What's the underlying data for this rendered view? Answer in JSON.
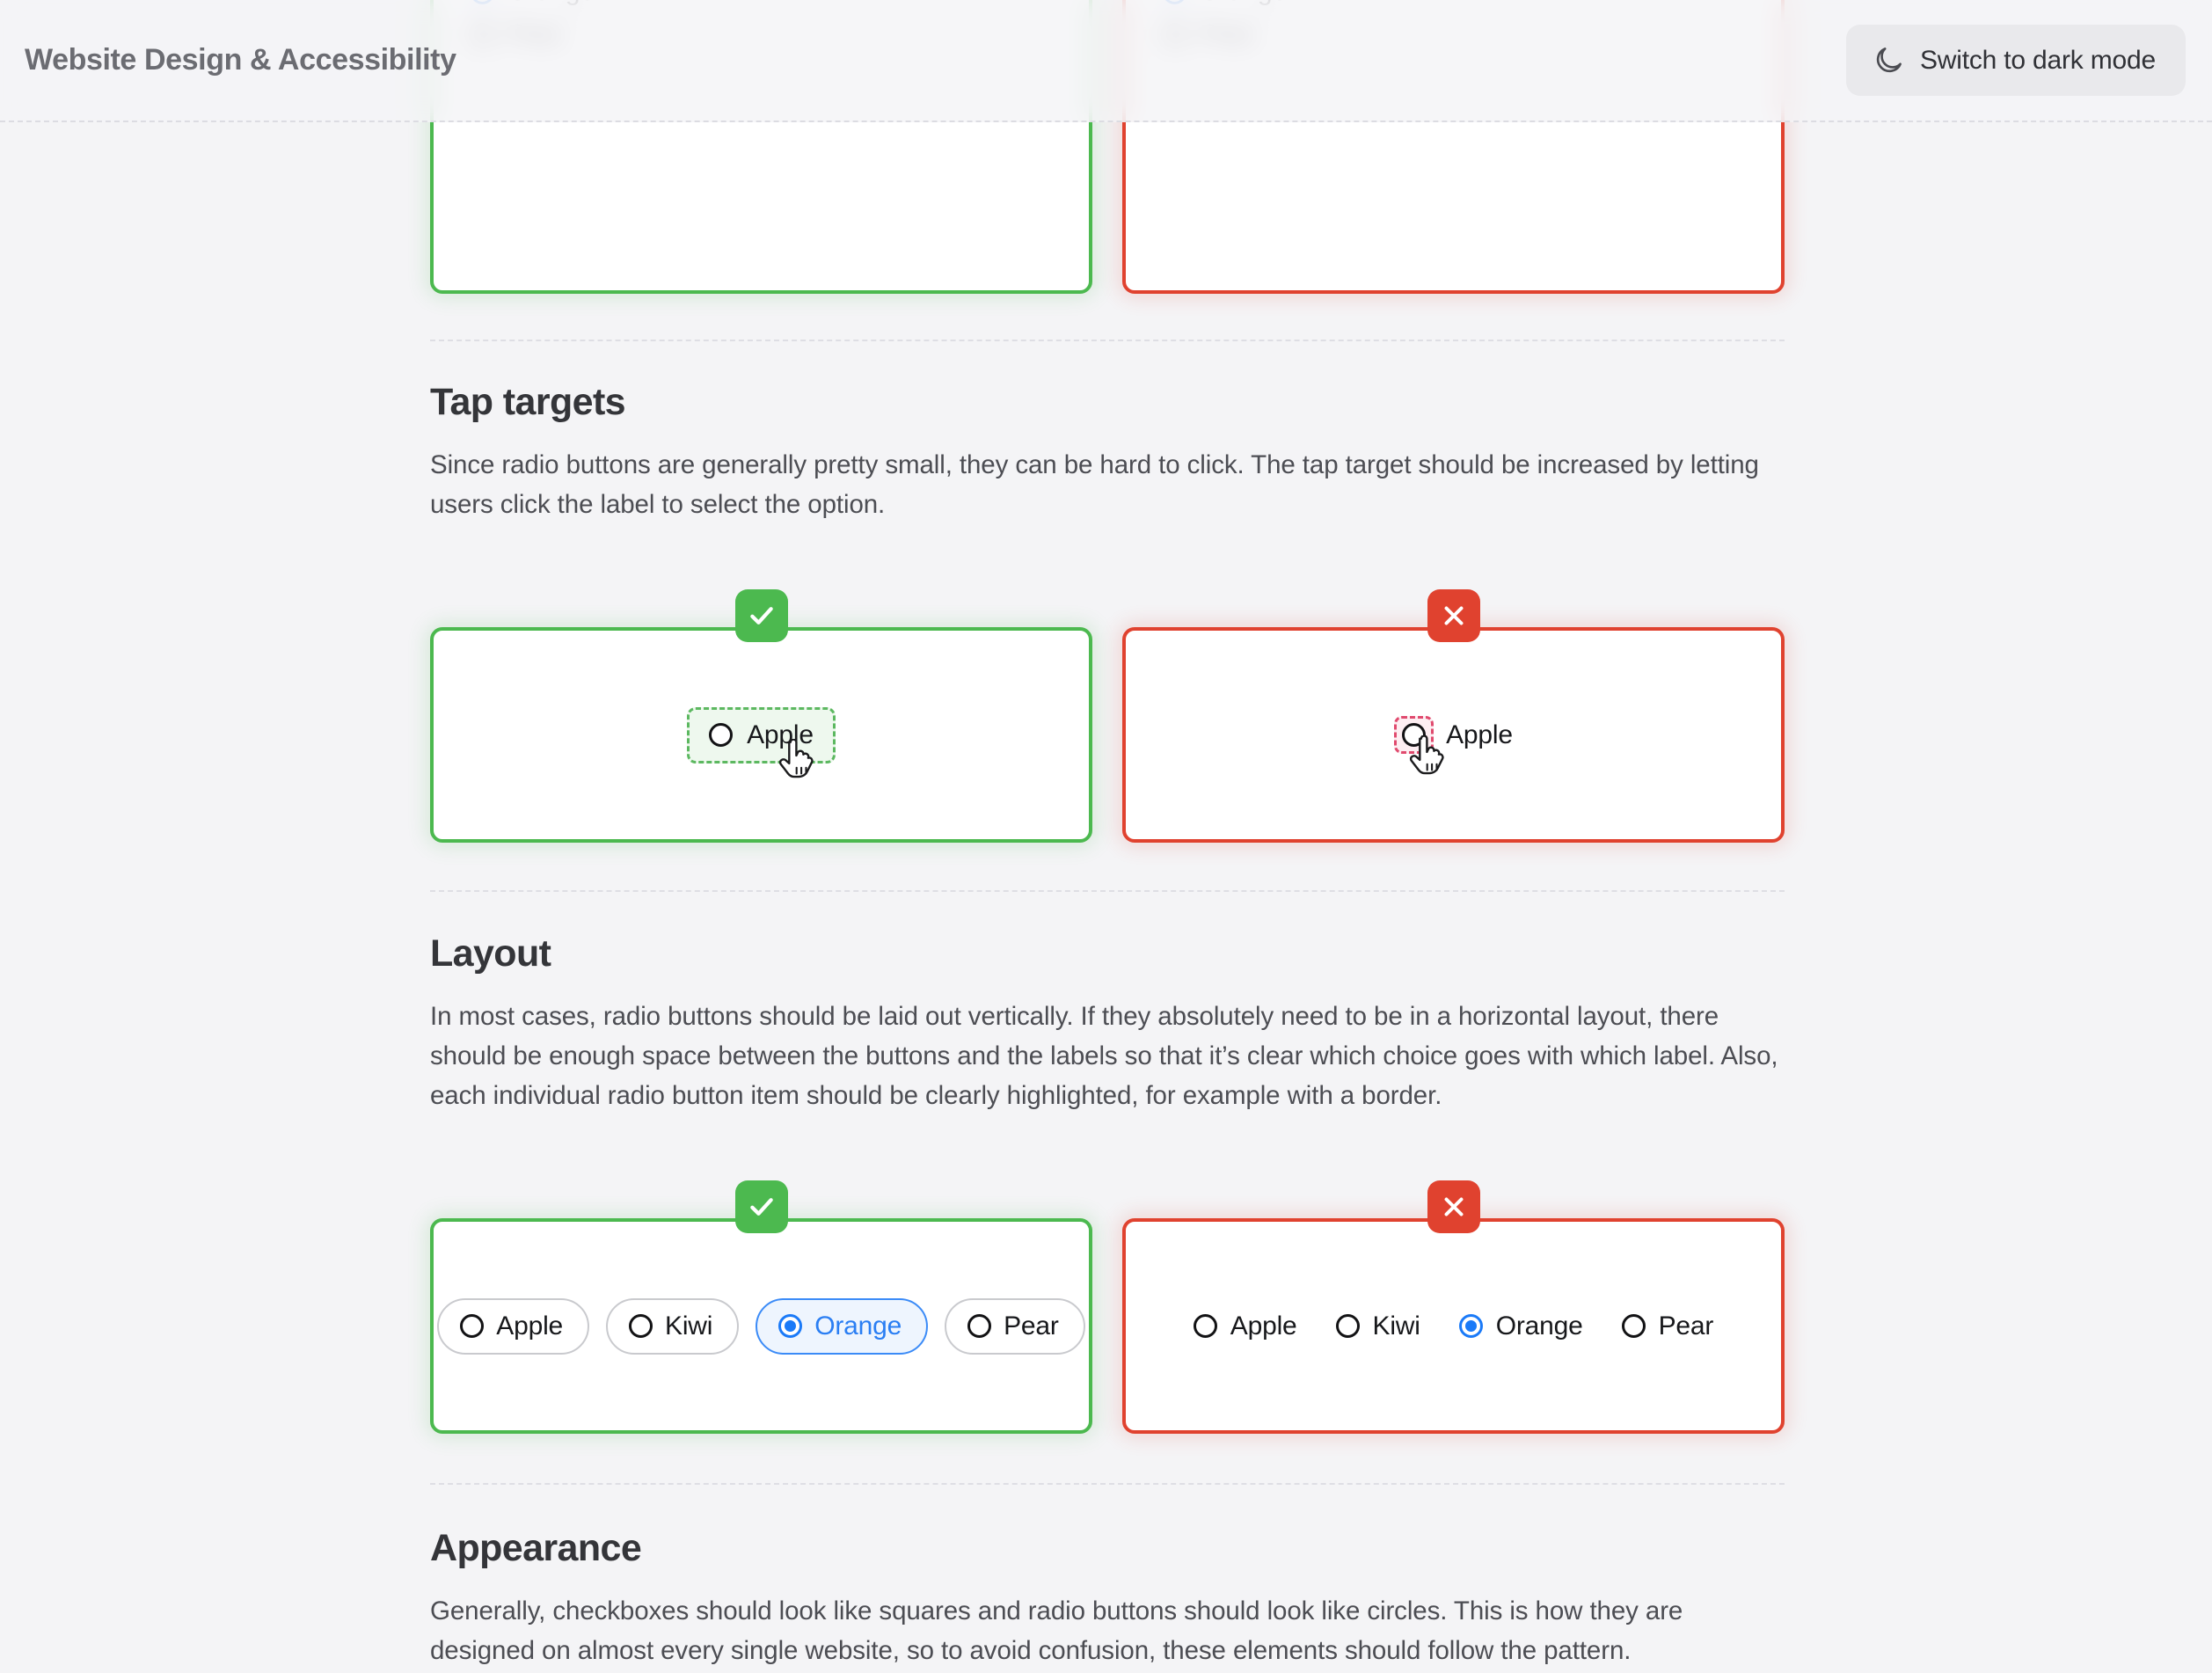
{
  "header": {
    "title": "Website Design & Accessibility",
    "theme_toggle_label": "Switch to dark mode",
    "theme_toggle_icon": "moon-icon"
  },
  "colors": {
    "page_background": "#f4f4f6",
    "good": "#4cb94f",
    "bad": "#e0422f",
    "accent_blue": "#1a7af8",
    "card_background": "#ffffff",
    "heading": "#343539",
    "body_text": "#4c4d53"
  },
  "top_section": {
    "good_card": {
      "verdict": "good",
      "verdict_icon": "check-icon",
      "options": [
        {
          "label": "Orange",
          "checked": true
        },
        {
          "label": "Pear",
          "checked": false
        }
      ]
    },
    "bad_card": {
      "verdict": "bad",
      "verdict_icon": "cross-icon",
      "options": [
        {
          "label": "Orange",
          "checked": true
        },
        {
          "label": "Pear",
          "checked": false
        }
      ]
    }
  },
  "sections": [
    {
      "id": "tap-targets",
      "title": "Tap targets",
      "body": "Since radio buttons are generally pretty small, they can be hard to click. The tap target should be increased by letting users click the label to select the option.",
      "good_card": {
        "verdict": "good",
        "verdict_icon": "check-icon",
        "option": {
          "label": "Apple",
          "checked": false
        },
        "cursor": "pointer-hand-cursor"
      },
      "bad_card": {
        "verdict": "bad",
        "verdict_icon": "cross-icon",
        "option": {
          "label": "Apple",
          "checked": false
        },
        "cursor": "pointer-hand-cursor"
      }
    },
    {
      "id": "layout",
      "title": "Layout",
      "body": "In most cases, radio buttons should be laid out vertically. If they absolutely need to be in a horizontal layout, there should be enough space between the buttons and the labels so that it’s clear which choice goes with which label. Also, each individual radio button item should be clearly highlighted, for example with a border.",
      "good_card": {
        "verdict": "good",
        "verdict_icon": "check-icon",
        "options": [
          {
            "label": "Apple",
            "checked": false
          },
          {
            "label": "Kiwi",
            "checked": false
          },
          {
            "label": "Orange",
            "checked": true
          },
          {
            "label": "Pear",
            "checked": false
          }
        ]
      },
      "bad_card": {
        "verdict": "bad",
        "verdict_icon": "cross-icon",
        "options": [
          {
            "label": "Apple",
            "checked": false
          },
          {
            "label": "Kiwi",
            "checked": false
          },
          {
            "label": "Orange",
            "checked": true
          },
          {
            "label": "Pear",
            "checked": false
          }
        ]
      }
    },
    {
      "id": "appearance",
      "title": "Appearance",
      "body": "Generally, checkboxes should look like squares and radio buttons should look like circles. This is how they are designed on almost every single website, so to avoid confusion, these elements should follow the pattern."
    }
  ]
}
